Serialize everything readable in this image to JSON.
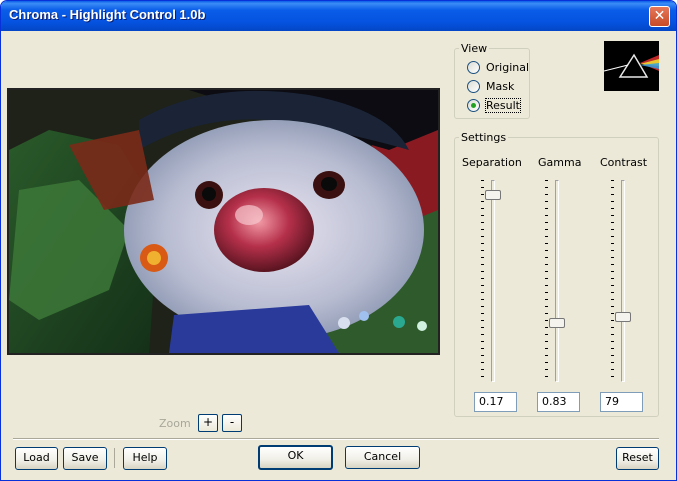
{
  "window": {
    "title": "Chroma - Highlight Control 1.0b",
    "close_glyph": "✕"
  },
  "view": {
    "legend": "View",
    "options": [
      {
        "label": "Original",
        "checked": false
      },
      {
        "label": "Mask",
        "checked": false
      },
      {
        "label": "Result",
        "checked": true
      }
    ]
  },
  "settings": {
    "legend": "Settings",
    "sliders": [
      {
        "label": "Separation",
        "value": "0.17",
        "level": 0.05
      },
      {
        "label": "Gamma",
        "value": "0.83",
        "level": 0.72
      },
      {
        "label": "Contrast",
        "value": "79",
        "level": 0.69
      }
    ]
  },
  "zoom": {
    "label": "Zoom",
    "plus": "+",
    "minus": "-"
  },
  "buttons": {
    "load": "Load",
    "save": "Save",
    "help": "Help",
    "ok": "OK",
    "cancel": "Cancel",
    "reset": "Reset"
  },
  "icons": {
    "logo": "prism-logo-icon",
    "close": "close-icon"
  },
  "colors": {
    "titlebar": "#0553e0",
    "window_bg": "#ece9d8",
    "radio_dot": "#21a121"
  }
}
